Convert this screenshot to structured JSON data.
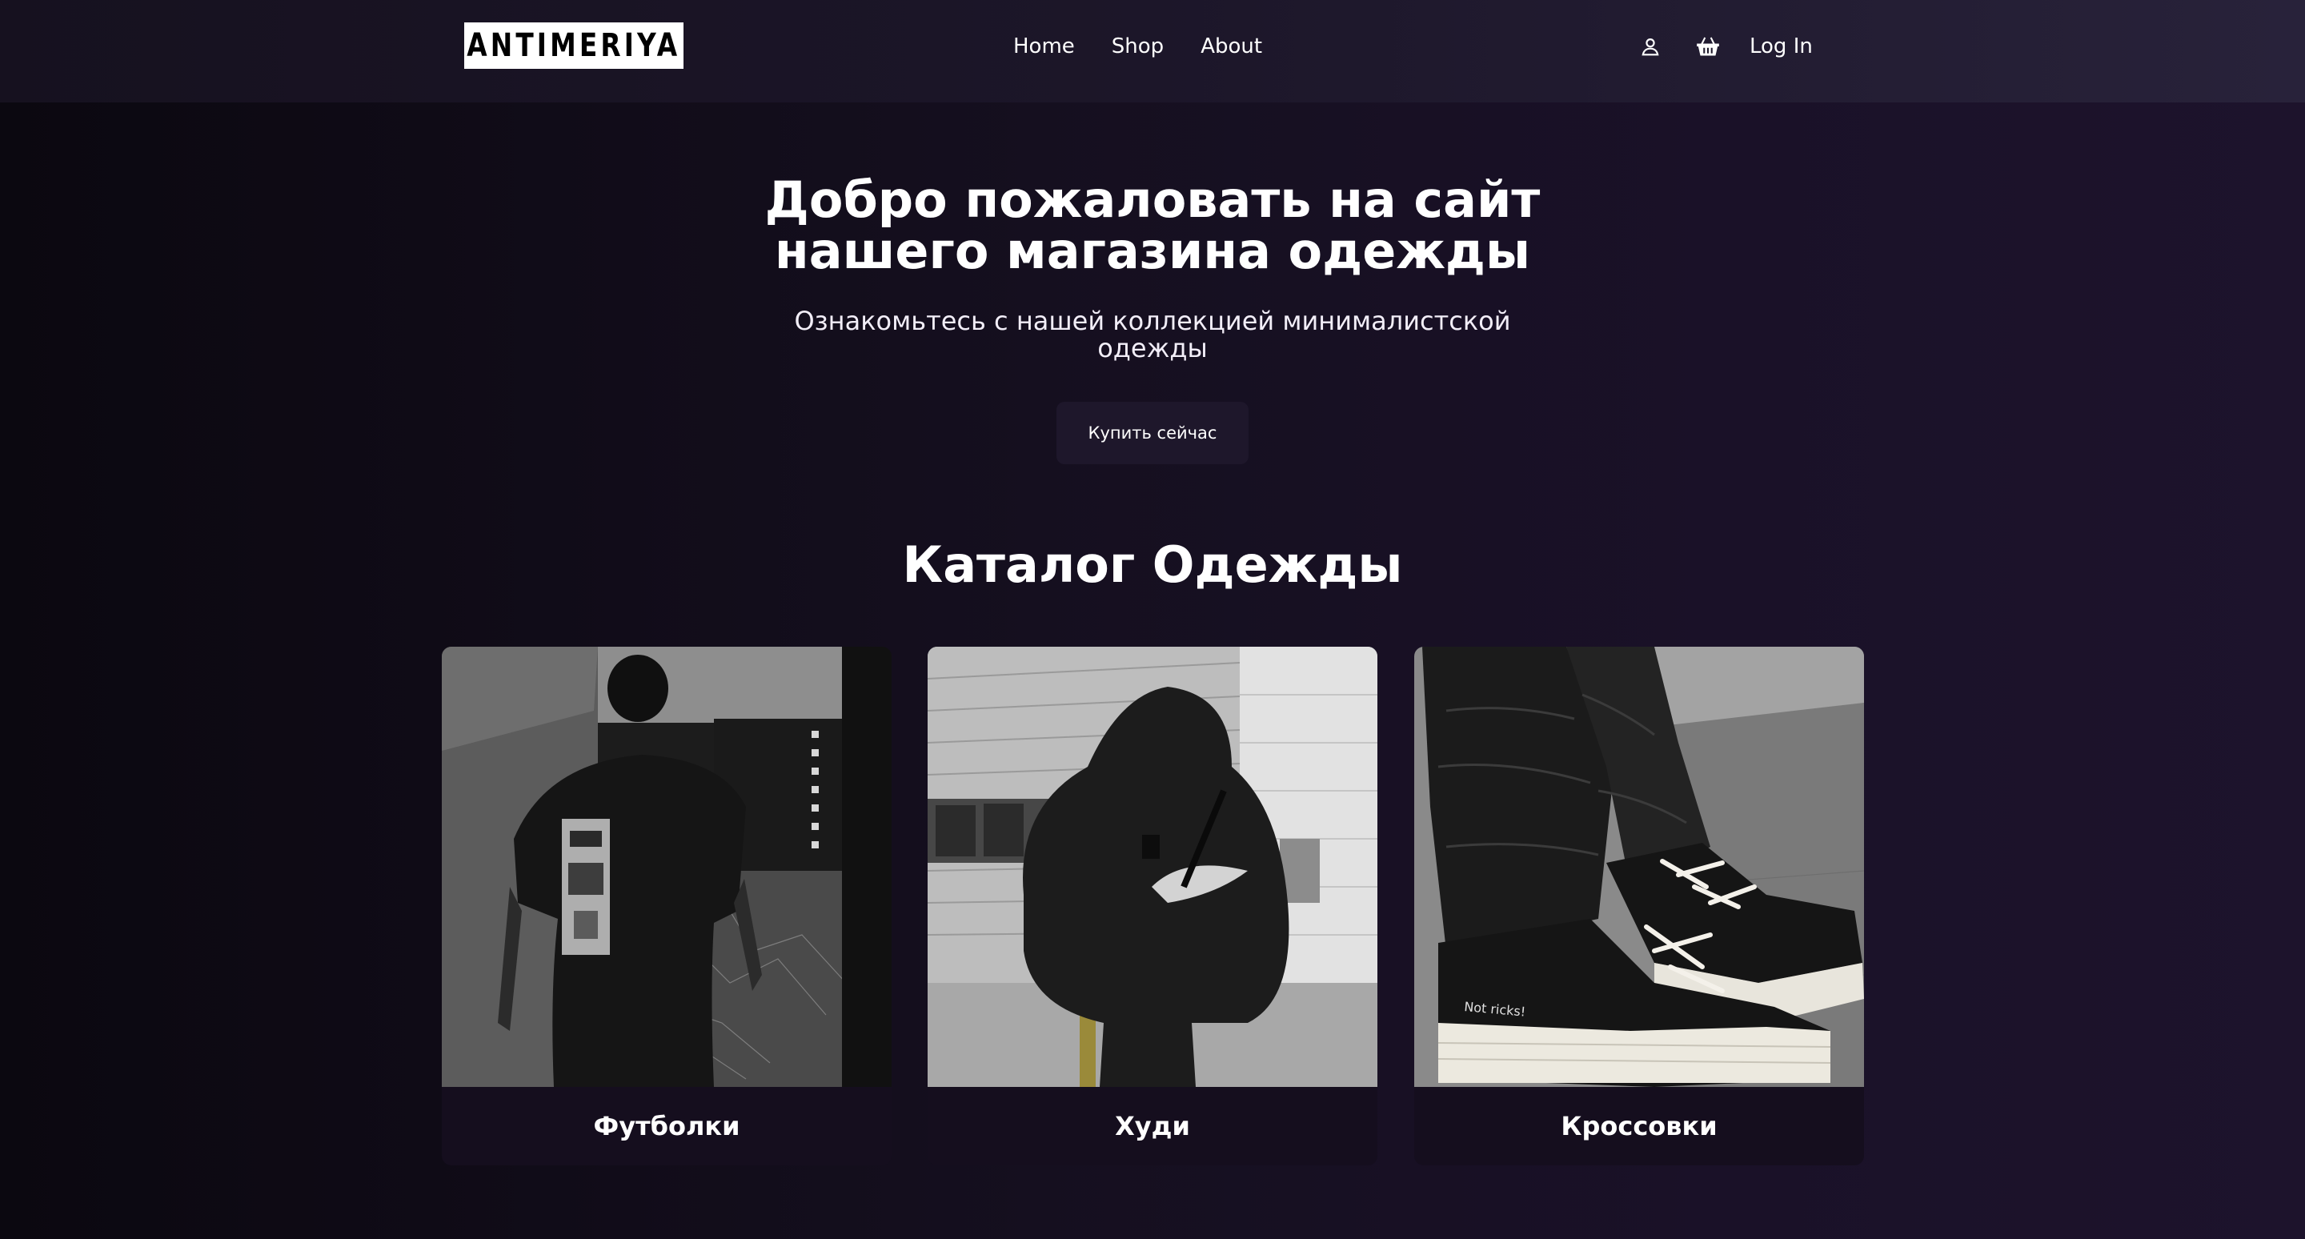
{
  "header": {
    "logo_text": "ANTIMERIYA",
    "nav": [
      {
        "label": "Home"
      },
      {
        "label": "Shop"
      },
      {
        "label": "About"
      }
    ],
    "icons": [
      "user-icon",
      "basket-icon"
    ],
    "login_label": "Log In"
  },
  "hero": {
    "title": "Добро пожаловать на сайт нашего магазина одежды",
    "subtitle": "Ознакомьтесь с нашей коллекцией минималистской одежды",
    "button_label": "Купить сейчас"
  },
  "catalog": {
    "title": "Каталог Одежды",
    "cards": [
      {
        "label": "Футболки"
      },
      {
        "label": "Худи"
      },
      {
        "label": "Кроссовки"
      }
    ]
  },
  "photo_text": {
    "shoe_print": "Not ricks!"
  },
  "colors": {
    "background": "#130d1c",
    "header": "#1c1629",
    "button": "#1e172b",
    "card": "#150e1e",
    "text": "#ffffff"
  }
}
